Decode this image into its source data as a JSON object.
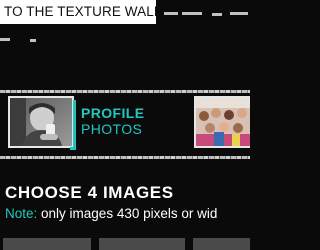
{
  "top_link": {
    "label": "TO THE TEXTURE WALL"
  },
  "tiles": [
    {
      "title_line1": "PROFILE",
      "title_line2": "PHOTOS",
      "accent": "#20c4bd"
    },
    {
      "title_line1": "",
      "title_line2": ""
    }
  ],
  "section": {
    "heading": "CHOOSE 4 IMAGES",
    "note_label": "Note:",
    "note_text": " only images 430 pixels or wid"
  },
  "colors": {
    "accent": "#22c7c0",
    "background": "#0a0a0a"
  },
  "image_slots": [
    {
      "state": "empty"
    },
    {
      "state": "empty"
    },
    {
      "state": "empty"
    }
  ]
}
